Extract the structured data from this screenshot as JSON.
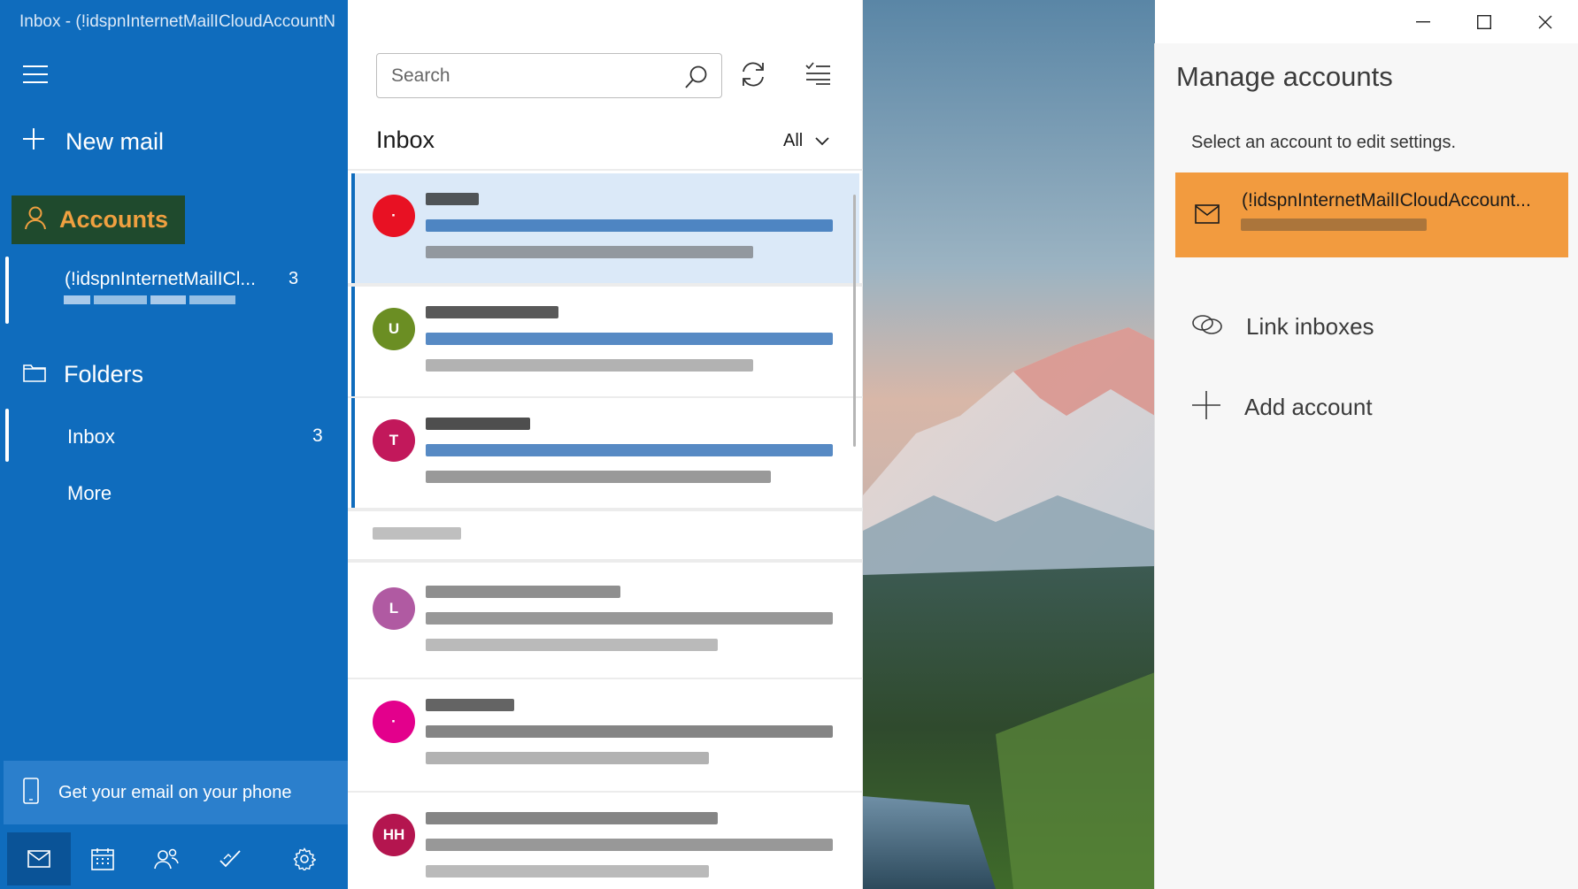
{
  "window": {
    "title": "Inbox - (!idspnInternetMailICloudAccountN"
  },
  "nav": {
    "new_mail_label": "New mail",
    "accounts_label": "Accounts",
    "account": {
      "name": "(!idspnInternetMailICl...",
      "unread": "3"
    },
    "folders_label": "Folders",
    "inbox": {
      "label": "Inbox",
      "unread": "3"
    },
    "more_label": "More",
    "phone_promo": "Get your email on your phone"
  },
  "list": {
    "search_placeholder": "Search",
    "folder_title": "Inbox",
    "filter_label": "All",
    "messages": [
      {
        "initial": "·",
        "color": "#e81123"
      },
      {
        "initial": "U",
        "color": "#6b8e23"
      },
      {
        "initial": "T",
        "color": "#c2185b"
      },
      {
        "initial": "L",
        "color": "#b05aa2"
      },
      {
        "initial": "·",
        "color": "#e3008c"
      },
      {
        "initial": "HH",
        "color": "#b4154f"
      }
    ]
  },
  "panel": {
    "title": "Manage accounts",
    "subtitle": "Select an account to edit settings.",
    "account_name": "(!idspnInternetMailICloudAccount...",
    "link_inboxes": "Link inboxes",
    "add_account": "Add account",
    "accent_color": "#f29b3f"
  },
  "theme": {
    "nav_blue": "#0f6cbd",
    "accounts_green": "#1f4a2d",
    "accounts_text": "#f0a040"
  }
}
